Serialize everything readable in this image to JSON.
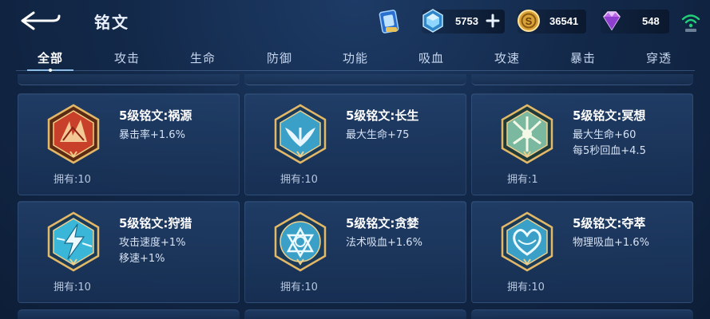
{
  "header": {
    "title": "铭文"
  },
  "resources": {
    "tickets": {
      "icon": "blue-ticket-icon"
    },
    "diamonds": {
      "icon": "blue-diamond-icon",
      "value": "5753"
    },
    "coins": {
      "icon": "gold-coin-icon",
      "value": "36541"
    },
    "gems": {
      "icon": "purple-gem-icon",
      "value": "548"
    },
    "network": {
      "icon": "wifi-signal-icon",
      "color": "#22d07a"
    }
  },
  "tabs": [
    {
      "label": "全部",
      "active": true
    },
    {
      "label": "攻击"
    },
    {
      "label": "生命"
    },
    {
      "label": "防御"
    },
    {
      "label": "功能"
    },
    {
      "label": "吸血"
    },
    {
      "label": "攻速"
    },
    {
      "label": "暴击"
    },
    {
      "label": "穿透"
    }
  ],
  "inscriptions": [
    {
      "name": "5级铭文:祸源",
      "attrs": [
        "暴击率+1.6%"
      ],
      "owned": "拥有:10",
      "color": "red",
      "icon": "red-inscription-badge-icon"
    },
    {
      "name": "5级铭文:长生",
      "attrs": [
        "最大生命+75"
      ],
      "owned": "拥有:10",
      "color": "blue",
      "icon": "blue-inscription-badge-icon"
    },
    {
      "name": "5级铭文:冥想",
      "attrs": [
        "最大生命+60",
        "每5秒回血+4.5"
      ],
      "owned": "拥有:1",
      "color": "green",
      "icon": "green-inscription-badge-icon"
    },
    {
      "name": "5级铭文:狩猎",
      "attrs": [
        "攻击速度+1%",
        "移速+1%"
      ],
      "owned": "拥有:10",
      "color": "blue",
      "icon": "blue-lightning-badge-icon"
    },
    {
      "name": "5级铭文:贪婪",
      "attrs": [
        "法术吸血+1.6%"
      ],
      "owned": "拥有:10",
      "color": "blue",
      "icon": "blue-knot-badge-icon"
    },
    {
      "name": "5级铭文:夺萃",
      "attrs": [
        "物理吸血+1.6%"
      ],
      "owned": "拥有:10",
      "color": "blue",
      "icon": "blue-heart-badge-icon"
    }
  ],
  "colors": {
    "background": "#13294a",
    "card": "#22406a",
    "gold_frame": "#c9a055",
    "red_badge": "#c8402a",
    "blue_badge": "#3aa0c8",
    "green_badge": "#7ab8a0"
  }
}
